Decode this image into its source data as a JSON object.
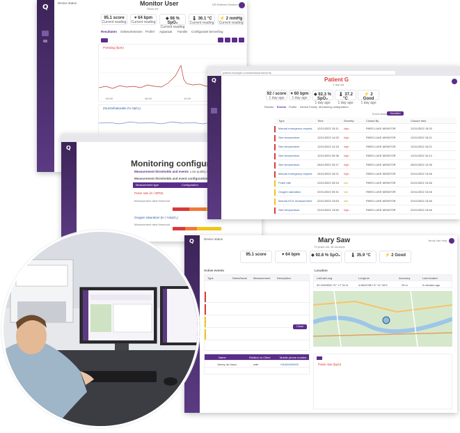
{
  "win1": {
    "title": "Monitor User",
    "subtitle": "Show me",
    "top_status": "Device status",
    "tiles": [
      {
        "v": "95.1 score",
        "s": "Current reading"
      },
      {
        "v": "♥ 64 bpm",
        "s": "Current reading"
      },
      {
        "v": "◆ 98 % SpO₂",
        "s": "Current reading"
      },
      {
        "v": "🌡 36.1 °C",
        "s": "Current reading"
      },
      {
        "v": "⚡ 2 mmHg",
        "s": "Current reading"
      }
    ],
    "tabs": [
      "Resultaten",
      "Gebeurtenissen",
      "Profiel",
      "Apparaat",
      "Familie",
      "Configuratie beroerling"
    ],
    "chart1_label": "Polsslag (bpm)",
    "chart2_label": "Zuurstofsaturatie (% SpO₂)",
    "ticks": [
      "00:00",
      "06:00",
      "12:00",
      "18:00"
    ],
    "user": "DR.Robbert Gardner"
  },
  "win2": {
    "url": "patient.example.com/dashboard/events",
    "title": "Patient G",
    "subtitle": "1 day old",
    "tiles": [
      {
        "v": "92 / score",
        "s": "1 day ago"
      },
      {
        "v": "♥ 60 bpm",
        "s": "1 day ago"
      },
      {
        "v": "◆ 92.3 % SpO₂",
        "s": "1 day ago"
      },
      {
        "v": "🌡 37.2 °C",
        "s": "1 day ago"
      },
      {
        "v": "⚡ 2 Good",
        "s": "1 day ago"
      }
    ],
    "tabs": [
      "Results",
      "Events",
      "Profile",
      "Device",
      "Family",
      "Monitoring configuration"
    ],
    "filter": "Event status",
    "filter_btn": "Handled",
    "cols": [
      "Type",
      "Time",
      "Severity",
      "Closed By",
      "Closure time"
    ],
    "rows": [
      {
        "t": "Manual emergency request",
        "time": "12/11/2022 15:11",
        "sev": "high",
        "by": "PARG LUKE MONITOR",
        "ct": "12/11/2022 15:20",
        "c": "#d93a3a"
      },
      {
        "t": "Skin temperature",
        "time": "12/11/2022 14:25",
        "sev": "high",
        "by": "PARG LUKE MONITOR",
        "ct": "12/11/2022 15:21",
        "c": "#d93a3a"
      },
      {
        "t": "Skin temperature",
        "time": "12/11/2022 14:18",
        "sev": "high",
        "by": "PARG LUKE MONITOR",
        "ct": "12/11/2022 15:21",
        "c": "#d93a3a"
      },
      {
        "t": "Skin temperature",
        "time": "12/11/2022 09:38",
        "sev": "high",
        "by": "PARG LUKE MONITOR",
        "ct": "12/11/2022 10:12",
        "c": "#d93a3a"
      },
      {
        "t": "Skin temperature",
        "time": "28/11/2022 20:17",
        "sev": "high",
        "by": "PARG LUKE MONITOR",
        "ct": "28/11/2022 12:35",
        "c": "#d93a3a"
      },
      {
        "t": "Manual emergency request",
        "time": "24/11/2022 15:21",
        "sev": "high",
        "by": "PARG LUKE MONITOR",
        "ct": "22/11/2022 13:46",
        "c": "#d93a3a"
      },
      {
        "t": "Pulse rate",
        "time": "22/11/2022 09:34",
        "sev": "low",
        "by": "PARG LUKE MONITOR",
        "ct": "22/11/2022 13:46",
        "c": "#f0c419"
      },
      {
        "t": "Oxygen saturation",
        "time": "22/11/2022 09:31",
        "sev": "low",
        "by": "PARG LUKE MONITOR",
        "ct": "22/11/2022 13:46",
        "c": "#f0c419"
      },
      {
        "t": "Manual ECG measurement",
        "time": "22/11/2022 13:53",
        "sev": "low",
        "by": "PARG LUKE MONITOR",
        "ct": "22/11/2022 13:46",
        "c": "#f0c419"
      },
      {
        "t": "Skin temperature",
        "time": "22/11/2022 13:50",
        "sev": "high",
        "by": "PARG LUKE MONITOR",
        "ct": "22/11/2022 13:46",
        "c": "#d93a3a"
      }
    ]
  },
  "win3": {
    "title": "Monitoring configuration",
    "tabs": [
      "Measurement thresholds and events",
      "Low-quality measurement events"
    ],
    "section": "Measurement thresholds and event configuration",
    "col1": "Measurement type",
    "col2": "Configuration",
    "items": [
      {
        "name": "Pulse rate (in / BPM)",
        "sub": "Measurement alert threshold"
      },
      {
        "name": "Oxygen saturation (in / %SpO₂)",
        "sub": "Measurement alert threshold"
      }
    ],
    "levels": [
      "High",
      "Medium",
      "Low",
      "Normal"
    ]
  },
  "win4": {
    "title": "Mary Saw",
    "subtitle": "73 years old, 46 seconds",
    "status": "Device status",
    "tiles": [
      {
        "v": "95.1 score"
      },
      {
        "v": "♥ 64 bpm"
      },
      {
        "v": "◆ 92.8 % SpO₂"
      },
      {
        "v": "🌡 35.9 °C"
      },
      {
        "v": "⚡ 2 Good"
      }
    ],
    "active_events": "Active events",
    "cols": [
      "Type",
      "Notes/Issue",
      "Measurement",
      "Description"
    ],
    "location": "Location",
    "loc_cols": [
      "Lat/Lat/Long",
      "Long/Lat",
      "Accuracy",
      "Last located"
    ],
    "loc_row": [
      "52.2020802/ 21° 17' 51 N",
      "4.8524785 / 6° 14' 28 E",
      "25 m",
      "5 minutes ago"
    ],
    "close": "Close",
    "contacts": [
      "Name",
      "Relation to Client",
      "Mobile phone number"
    ],
    "contact_row": [
      "Jimmy de Haan",
      "wife",
      "+31620000000"
    ],
    "pulse": "Pulse rate (bpm)",
    "user": "Jenny Van Hop"
  }
}
